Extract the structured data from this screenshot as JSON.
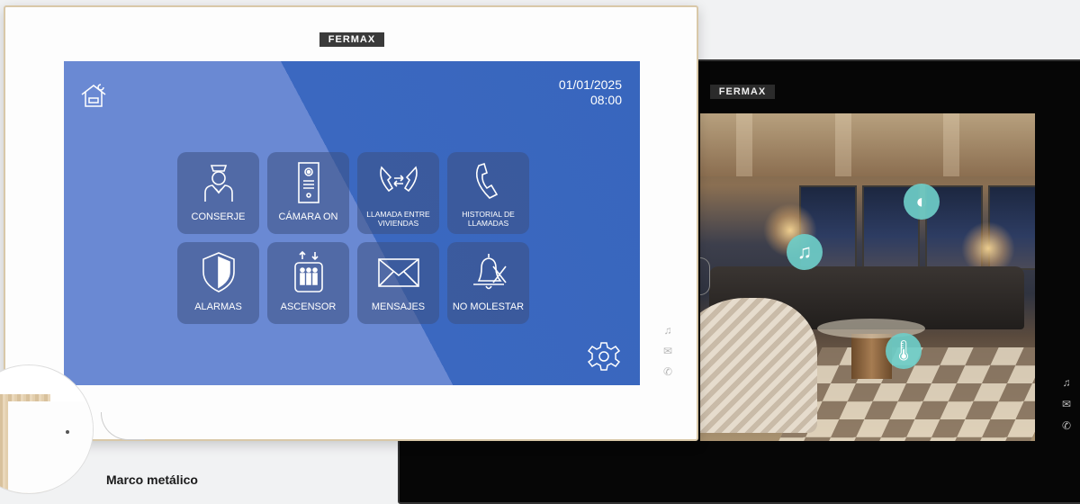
{
  "back_monitor": {
    "logo": "FERMAX",
    "overlay_icons": [
      "music-note-icon",
      "light-brightness-icon",
      "thermometer-icon"
    ],
    "side_icons": [
      "bell-icon",
      "envelope-icon",
      "phone-icon"
    ]
  },
  "front_monitor": {
    "logo": "FERMAX",
    "screen": {
      "date": "01/01/2025",
      "time": "08:00",
      "tiles": [
        {
          "label": "CONSERJE",
          "icon": "concierge-icon"
        },
        {
          "label": "CÁMARA ON",
          "icon": "door-panel-icon"
        },
        {
          "label": "LLAMADA ENTRE VIVIENDAS",
          "icon": "intercall-icon"
        },
        {
          "label": "HISTORIAL DE LLAMADAS",
          "icon": "phone-icon"
        },
        {
          "label": "ALARMAS",
          "icon": "shield-icon"
        },
        {
          "label": "ASCENSOR",
          "icon": "elevator-icon"
        },
        {
          "label": "MENSAJES",
          "icon": "envelope-icon"
        },
        {
          "label": "NO MOLESTAR",
          "icon": "bell-off-icon"
        }
      ]
    },
    "side_icons": [
      "bell-icon",
      "envelope-icon",
      "phone-icon"
    ]
  },
  "caption": "Marco metálico"
}
